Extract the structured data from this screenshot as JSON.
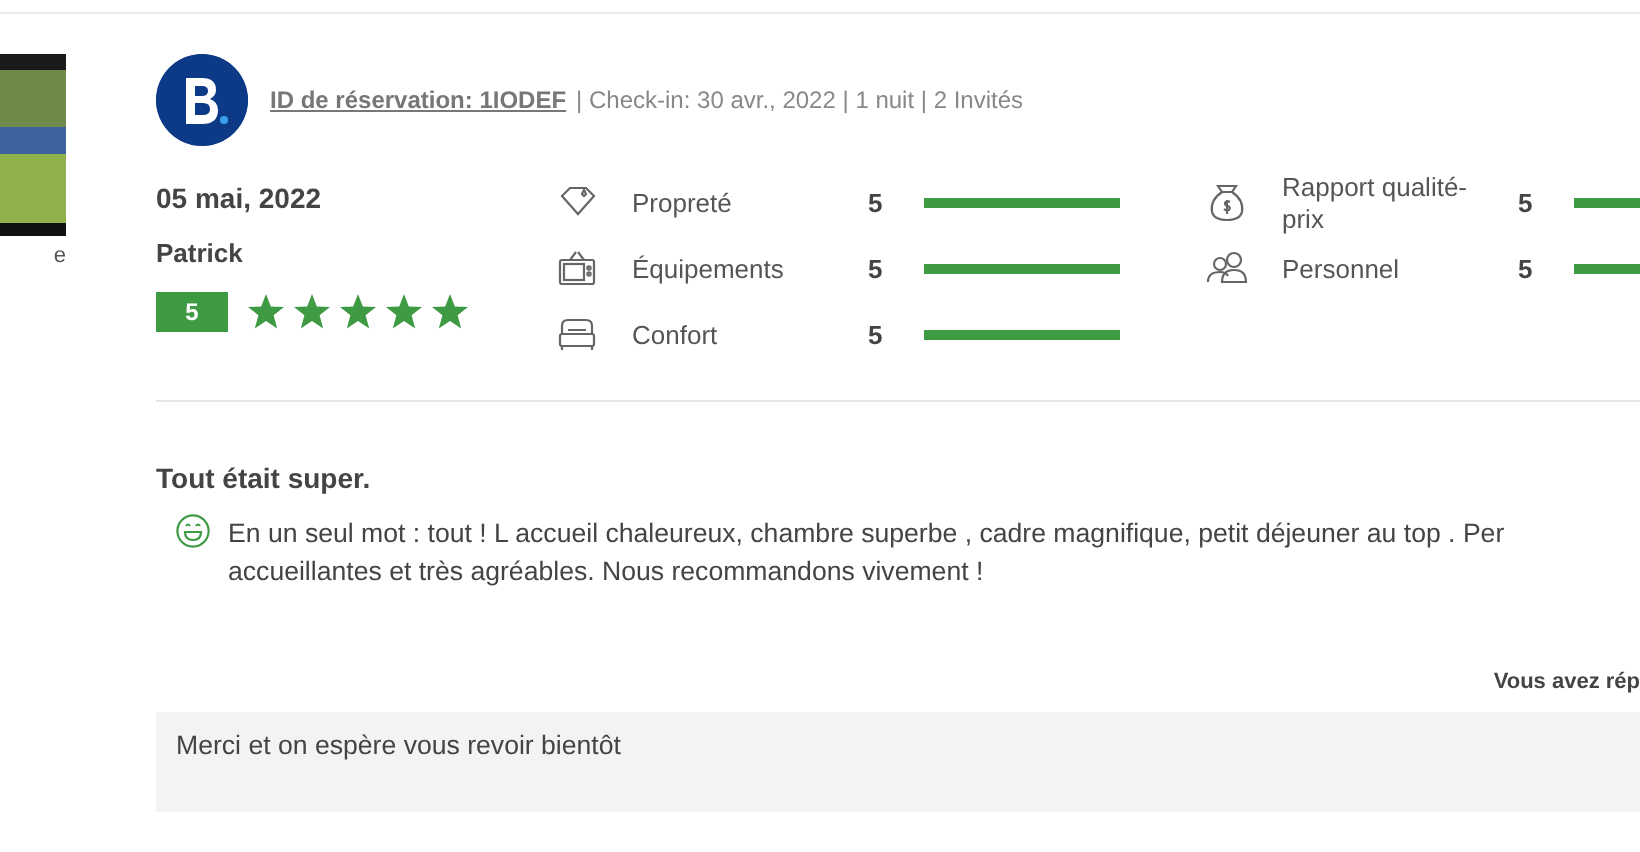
{
  "side": {
    "caption": "e"
  },
  "review": {
    "booking_id": "ID de réservation: 1IODEF",
    "details": "| Check-in: 30 avr., 2022 | 1 nuit | 2 Invités",
    "date": "05 mai, 2022",
    "author": "Patrick",
    "score": "5",
    "stars": 5,
    "ratings": [
      {
        "kind": "diamond",
        "label": "Propreté",
        "score": "5",
        "level": 1
      },
      {
        "kind": "tv",
        "label": "Équipements",
        "score": "5",
        "level": 1
      },
      {
        "kind": "bed",
        "label": "Confort",
        "score": "5",
        "level": 1
      },
      {
        "kind": "money",
        "label": "Rapport qualité-prix",
        "score": "5",
        "level": 1
      },
      {
        "kind": "people",
        "label": "Personnel",
        "score": "5",
        "level": 1
      }
    ],
    "title": "Tout était super.",
    "text": "En un seul mot : tout ! L accueil chaleureux, chambre superbe , cadre magnifique, petit déjeuner au top . Per accueillantes et très agréables. Nous recommandons vivement !",
    "reply_label": "Vous avez rép",
    "reply": "Merci et on espère vous revoir bientôt"
  }
}
